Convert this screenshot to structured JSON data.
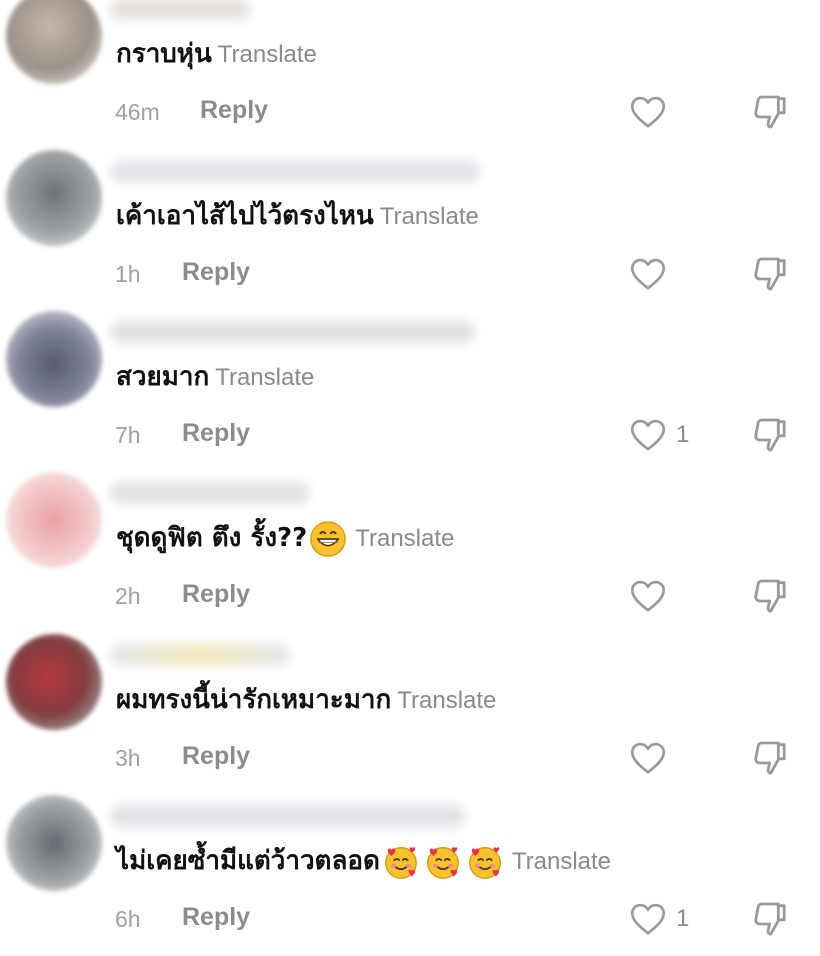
{
  "comments": [
    {
      "text": "กราบหุ่น",
      "translate": "Translate",
      "time": "46m",
      "reply": "Reply",
      "likes": "",
      "avatar_color": "#9b9188"
    },
    {
      "text": "เค้าเอาไส้ไปไว้ตรงไหน",
      "translate": "Translate",
      "time": "1h",
      "reply": "Reply",
      "likes": "",
      "avatar_color": "#7e8388"
    },
    {
      "text": "สวยมาก",
      "translate": "Translate",
      "time": "7h",
      "reply": "Reply",
      "likes": "1",
      "avatar_color": "#4c5266"
    },
    {
      "text": "ชุดดูฟิต ตึง รั้ง??",
      "translate": "Translate",
      "time": "2h",
      "reply": "Reply",
      "likes": "",
      "avatar_color": "#e6a4a6",
      "emoji": "grinning-face"
    },
    {
      "text": "ผมทรงนี้น่ารักเหมาะมาก",
      "translate": "Translate",
      "time": "3h",
      "reply": "Reply",
      "likes": "",
      "avatar_color": "#8c2a2c"
    },
    {
      "text": "ไม่เคยซ้ำมีแต่ว้าวตลอด",
      "translate": "Translate",
      "time": "6h",
      "reply": "Reply",
      "likes": "1",
      "avatar_color": "#6e7478",
      "emoji": "smiling-face-with-hearts"
    }
  ],
  "icons": {
    "like": "heart-outline-icon",
    "dislike": "thumbs-down-outline-icon"
  },
  "colors": {
    "muted_text": "#8c8c8c",
    "time_text": "#a0a0a0",
    "comment_text": "#111111"
  }
}
